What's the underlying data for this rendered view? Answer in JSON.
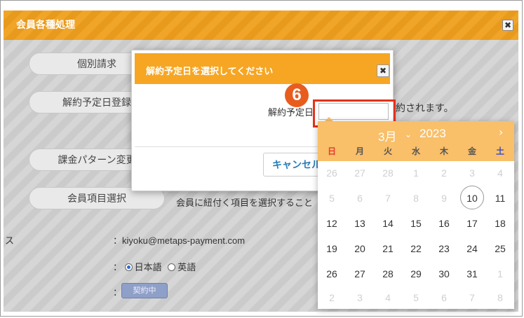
{
  "background": {
    "title": "会員各種処理",
    "close_icon": "✖",
    "buttons": [
      {
        "label": "個別請求"
      },
      {
        "label": "解約予定日登録"
      },
      {
        "label": "課金パターン変更"
      },
      {
        "label": "会員項目選択"
      }
    ],
    "member_item_desc": "会員に紐付く項目を選択すること",
    "notice_right": "約されます。",
    "row_label_fragment": "ス",
    "email": "：kiyoku@metaps-payment.com",
    "language_prefix": "：",
    "language_options": [
      {
        "label": "日本語",
        "selected": true
      },
      {
        "label": "英語",
        "selected": false
      }
    ],
    "status_prefix": "：",
    "status_badge": "契約中"
  },
  "modal": {
    "title": "解約予定日を選択してください",
    "close_icon": "✖",
    "field_label": "解約予定日",
    "input_value": "",
    "cancel_label": "キャンセル"
  },
  "step_badge": "6",
  "calendar": {
    "month_label": "3月",
    "year_label": "2023",
    "month_dropdown_icon": "⌄",
    "next_icon": "›",
    "weekdays": [
      "日",
      "月",
      "火",
      "水",
      "木",
      "金",
      "土"
    ],
    "weekday_colors": [
      "#e23b2e",
      "#555555",
      "#555555",
      "#555555",
      "#555555",
      "#555555",
      "#3a4bc8"
    ],
    "weeks": [
      [
        "26",
        "27",
        "28",
        "1",
        "2",
        "3",
        "4"
      ],
      [
        "5",
        "6",
        "7",
        "8",
        "9",
        "10",
        "11"
      ],
      [
        "12",
        "13",
        "14",
        "15",
        "16",
        "17",
        "18"
      ],
      [
        "19",
        "20",
        "21",
        "22",
        "23",
        "24",
        "25"
      ],
      [
        "26",
        "27",
        "28",
        "29",
        "30",
        "31",
        "1"
      ],
      [
        "2",
        "3",
        "4",
        "5",
        "6",
        "7",
        "8"
      ]
    ],
    "muted_row0": 7,
    "muted_row1_upto": 5,
    "today": "10"
  },
  "colors": {
    "accent": "#f6a623",
    "highlight": "#e4321b",
    "badge": "#e85d1e"
  }
}
